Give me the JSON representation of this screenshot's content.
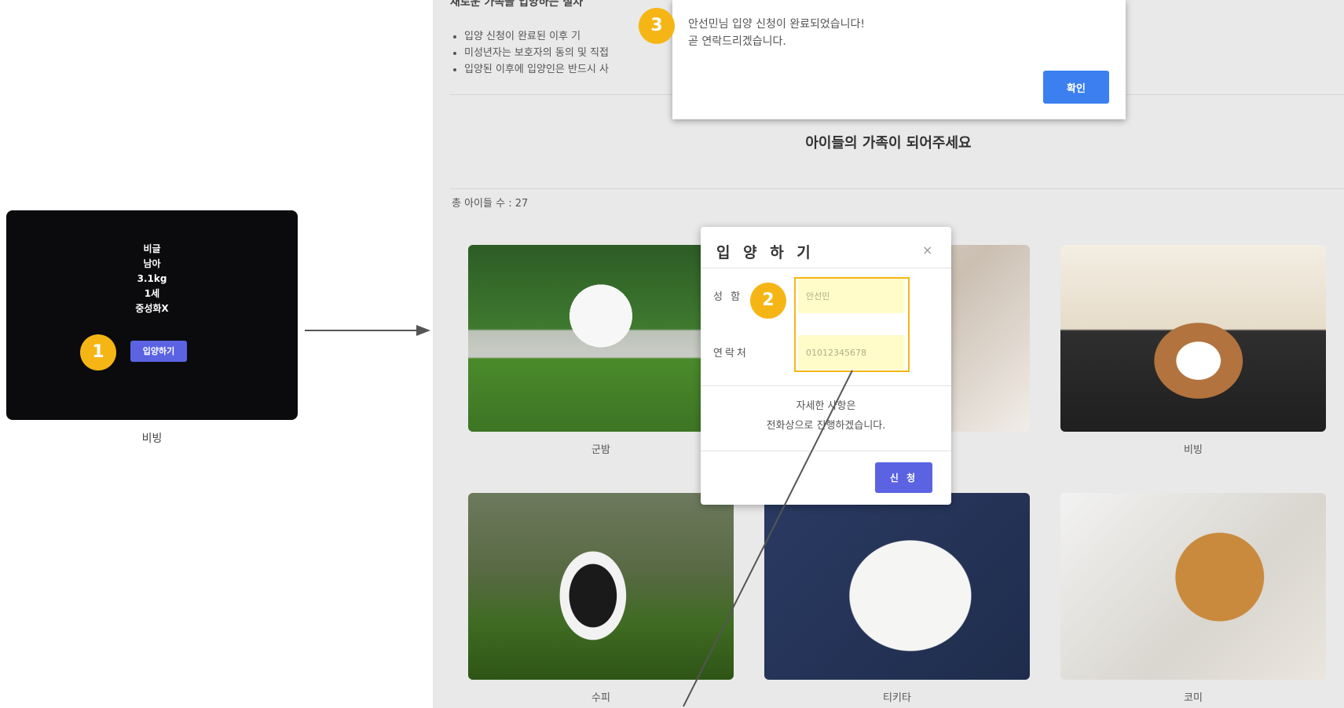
{
  "detail_card": {
    "breed": "비글",
    "gender": "남아",
    "weight": "3.1kg",
    "age": "1세",
    "neutered": "중성화X",
    "adopt_button": "입양하기",
    "caption": "비빙"
  },
  "steps": [
    "1",
    "2",
    "3"
  ],
  "page": {
    "notice_heading": "새로운 가족을 입양하는 절차",
    "notice_items": [
      "입양 신청이 완료된 이후 기",
      "미성년자는 보호자의 동의 및 직접",
      "입양된 이후에 입양인은 반드시 사"
    ],
    "section_title": "아이들의 가족이 되어주세요",
    "total_count": "총 아이들 수 : 27",
    "pets": [
      {
        "name": "군밤"
      },
      {
        "name": ""
      },
      {
        "name": "비빙"
      },
      {
        "name": "수피"
      },
      {
        "name": "티키타"
      },
      {
        "name": "코미"
      }
    ]
  },
  "alert": {
    "message_line1": "안선민님 입양 신청이 완료되었습니다!",
    "message_line2": "곧 연락드리겠습니다.",
    "ok_button": "확인"
  },
  "modal": {
    "title": "입 양 하 기",
    "close": "×",
    "name_label": "성 함",
    "name_value": "안선민",
    "contact_label": "연락처",
    "contact_value": "01012345678",
    "desc_line1": "자세한 사항은",
    "desc_line2": "전화상으로 진행하겠습니다.",
    "submit_button": "신 청"
  },
  "colors": {
    "badge": "#f5b615",
    "primary_button": "#5b63e3",
    "alert_button": "#3b7ff0",
    "highlight_fill": "#fffcc9"
  }
}
